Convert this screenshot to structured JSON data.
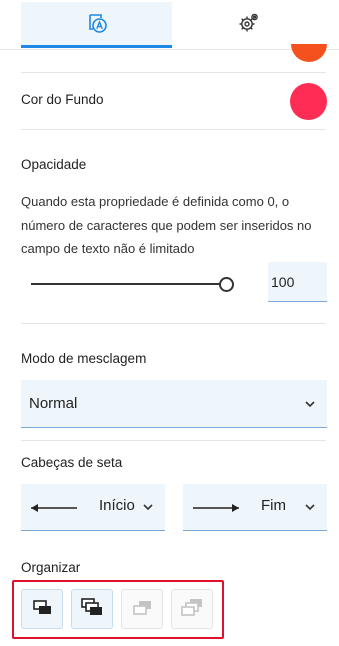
{
  "tabs": [
    {
      "icon": "text-style-icon",
      "active": true
    },
    {
      "icon": "gear-icon",
      "active": false
    }
  ],
  "colors": {
    "accent": "#1e88e5",
    "swatch_top": "#f4511e",
    "background_swatch": "#ff2d55",
    "highlight_border": "#e0102a"
  },
  "background_color": {
    "label": "Cor do Fundo"
  },
  "opacity": {
    "label": "Opacidade",
    "description": "Quando esta propriedade é definida como 0, o número de caracteres que podem ser inseridos no campo de texto não é limitado",
    "value": "100",
    "level": 1.0
  },
  "blend_mode": {
    "label": "Modo de mesclagem",
    "value": "Normal"
  },
  "arrowheads": {
    "label": "Cabeças de seta",
    "start": "Início",
    "end": "Fim"
  },
  "arrange": {
    "label": "Organizar",
    "buttons": [
      {
        "icon": "bring-forward-icon",
        "enabled": true
      },
      {
        "icon": "bring-to-front-icon",
        "enabled": true
      },
      {
        "icon": "send-backward-icon",
        "enabled": false
      },
      {
        "icon": "send-to-back-icon",
        "enabled": false
      }
    ]
  }
}
